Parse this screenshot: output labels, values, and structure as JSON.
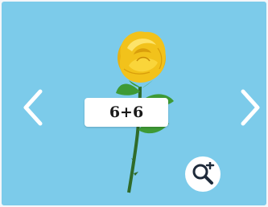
{
  "card": {
    "background": "#7ccbea",
    "label_text": "6+6",
    "flower": "yellow-rose"
  },
  "nav": {
    "prev_icon": "chevron-left-icon",
    "next_icon": "chevron-right-icon"
  },
  "zoom": {
    "icon": "zoom-in-icon"
  },
  "colors": {
    "chevron": "#ffffff",
    "petal": "#f2c21b",
    "stem": "#2f6b2a",
    "leaf": "#3e9a35"
  }
}
